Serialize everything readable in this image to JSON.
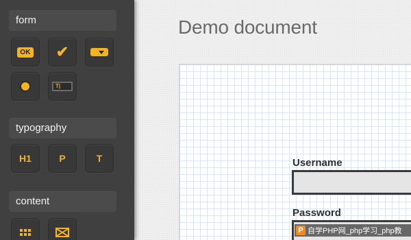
{
  "sidebar": {
    "sections": [
      {
        "label": "form",
        "tools": [
          {
            "icon": "ok-button-icon",
            "text": "OK"
          },
          {
            "icon": "checkbox-icon",
            "text": "✔"
          },
          {
            "icon": "select-dropdown-icon",
            "text": ""
          },
          {
            "icon": "radio-button-icon",
            "text": ""
          },
          {
            "icon": "text-field-icon",
            "text": "T|"
          }
        ]
      },
      {
        "label": "typography",
        "tools": [
          {
            "icon": "heading-icon",
            "text": "H1"
          },
          {
            "icon": "paragraph-icon",
            "text": "P"
          },
          {
            "icon": "text-icon",
            "text": "T"
          }
        ]
      },
      {
        "label": "content",
        "tools": [
          {
            "icon": "grid-icon",
            "text": ""
          },
          {
            "icon": "image-placeholder-icon",
            "text": ""
          }
        ]
      }
    ]
  },
  "main": {
    "title": "Demo document",
    "fields": [
      {
        "label": "Username",
        "value": ""
      },
      {
        "label": "Password",
        "value": ""
      }
    ]
  },
  "watermark": {
    "logo": "P",
    "text": "自学PHP网_php学习_php教"
  },
  "colors": {
    "sidebar_bg": "#404040",
    "accent": "#f4b31f",
    "grid_line": "#dce6f2"
  }
}
